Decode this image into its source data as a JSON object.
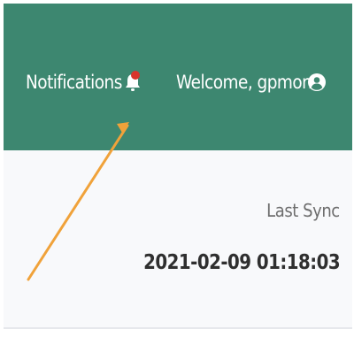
{
  "header": {
    "notifications_label": "Notifications",
    "welcome_label": "Welcome, gpmon",
    "background_color": "#3d8770",
    "notification_dot_color": "#d9342b"
  },
  "sync": {
    "label": "Last Sync",
    "timestamp": "2021-02-09 01:18:03"
  },
  "annotation": {
    "arrow_color": "#f0a23a"
  },
  "icons": {
    "bell": "bell-icon",
    "user": "user-circle-icon",
    "dot": "notification-dot"
  }
}
